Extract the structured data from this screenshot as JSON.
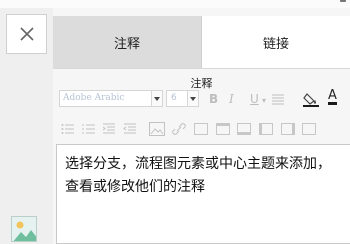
{
  "tabs": {
    "notes": "注释",
    "links": "链接"
  },
  "panel_title": "注释",
  "toolbar": {
    "font_family": "Adobe Arabic",
    "font_size": "6",
    "bold": "B",
    "italic": "I",
    "underline": "U",
    "color_letter": "A",
    "accent_color": "#1a1a1a",
    "icons_row1": [
      "bold-icon",
      "italic-icon",
      "underline-icon",
      "strikethrough-icon",
      "fill-color-icon",
      "font-color-icon"
    ],
    "icons_row2": [
      "bullet-list-icon",
      "numbered-list-icon",
      "indent-icon",
      "outdent-icon",
      "image-icon",
      "link-icon",
      "table-icon",
      "insert-row-icon",
      "delete-row-icon",
      "insert-column-icon",
      "merge-cells-icon",
      "split-cells-icon"
    ]
  },
  "note_text": "选择分支，流程图元素或中心主题来添加，查看或修改他们的注释"
}
